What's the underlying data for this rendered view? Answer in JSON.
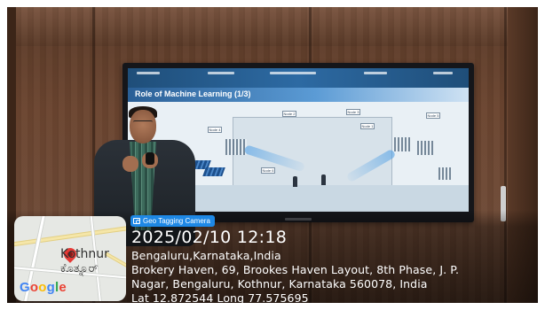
{
  "slide": {
    "title": "Role of Machine Learning (1/3)",
    "node_labels": [
      "Node 1",
      "Node 2",
      "Node 3",
      "Node 4",
      "Node 5",
      "Node 6"
    ]
  },
  "geotag": {
    "app_badge": "Geo Tagging Camera",
    "datetime": "2025/02/10 12:18",
    "city_line": "Bengaluru,Karnataka,India",
    "address_line1": "Brokery Haven, 69, Brookes Haven Layout, 8th Phase, J. P.",
    "address_line2": "Nagar, Bengaluru, Kothnur, Karnataka 560078, India",
    "coords_line": "Lat 12.872544 Long 77.575695"
  },
  "map": {
    "place_en": "Kothnur",
    "place_kn": "ಕೊತ್ನೂರ್",
    "logo": [
      "G",
      "o",
      "o",
      "g",
      "l",
      "e"
    ]
  },
  "colors": {
    "badge": "#1e88e5",
    "slide_header": "#1f4e79",
    "pin": "#e53935"
  }
}
